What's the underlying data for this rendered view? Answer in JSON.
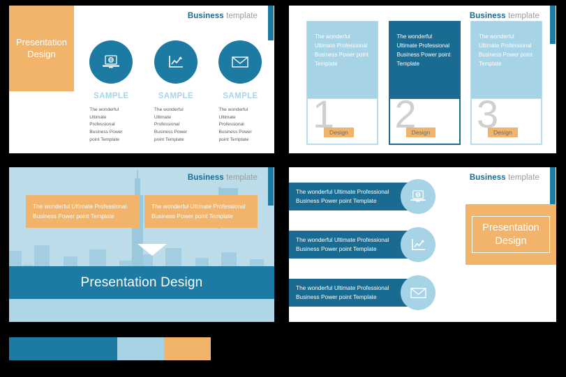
{
  "header": {
    "bold": "Business",
    "light": " template"
  },
  "slide1": {
    "title_box": "Presentation\nDesign",
    "items": [
      {
        "icon": "laptop-globe-icon",
        "label": "SAMPLE",
        "body": "The wonderful Ultimate Professional Business Power point Template"
      },
      {
        "icon": "line-chart-icon",
        "label": "SAMPLE",
        "body": "The wonderful Ultimate Professional Business Power point Template"
      },
      {
        "icon": "envelope-icon",
        "label": "SAMPLE",
        "body": "The wonderful Ultimate Professional Business Power point Template"
      }
    ]
  },
  "slide2": {
    "columns": [
      {
        "text": "The wonderful Ultimate Professional Business Power point Template",
        "number": "1",
        "button": "Design",
        "style": "light"
      },
      {
        "text": "The wonderful Ultimate Professional Business Power point Template",
        "number": "2",
        "button": "Design",
        "style": "dark"
      },
      {
        "text": "The wonderful Ultimate Professional Business Power point Template",
        "number": "3",
        "button": "Design",
        "style": "light"
      }
    ]
  },
  "slide3": {
    "boxes": [
      "The wonderful Ultimate Professional Business Power point Template",
      "The wonderful Ultimate Professional Business Power point Template"
    ],
    "banner": "Presentation Design"
  },
  "slide4": {
    "rows": [
      {
        "text": "The wonderful Ultimate Professional Business Power point Template",
        "icon": "laptop-globe-icon"
      },
      {
        "text": "The wonderful Ultimate Professional Business Power point Template",
        "icon": "line-chart-icon"
      },
      {
        "text": "The wonderful Ultimate Professional Business Power point Template",
        "icon": "envelope-icon"
      }
    ],
    "callout": "Presentation\nDesign"
  },
  "palette": {
    "swatches": [
      {
        "name": "dark-blue",
        "hex": "#1d7ba3"
      },
      {
        "name": "light-blue",
        "hex": "#a6d4e6"
      },
      {
        "name": "orange",
        "hex": "#f2b36a"
      }
    ]
  },
  "colors": {
    "dark_blue": "#1d7ba3",
    "deep_blue": "#1a6b92",
    "light_blue": "#a6d4e6",
    "pale_blue": "#bcdcea",
    "orange": "#f2b36a",
    "sample_text": "#a8d5e8",
    "body_text": "#58595b",
    "number_gray": "#cfcfcf",
    "header_light": "#9a9a9a"
  }
}
